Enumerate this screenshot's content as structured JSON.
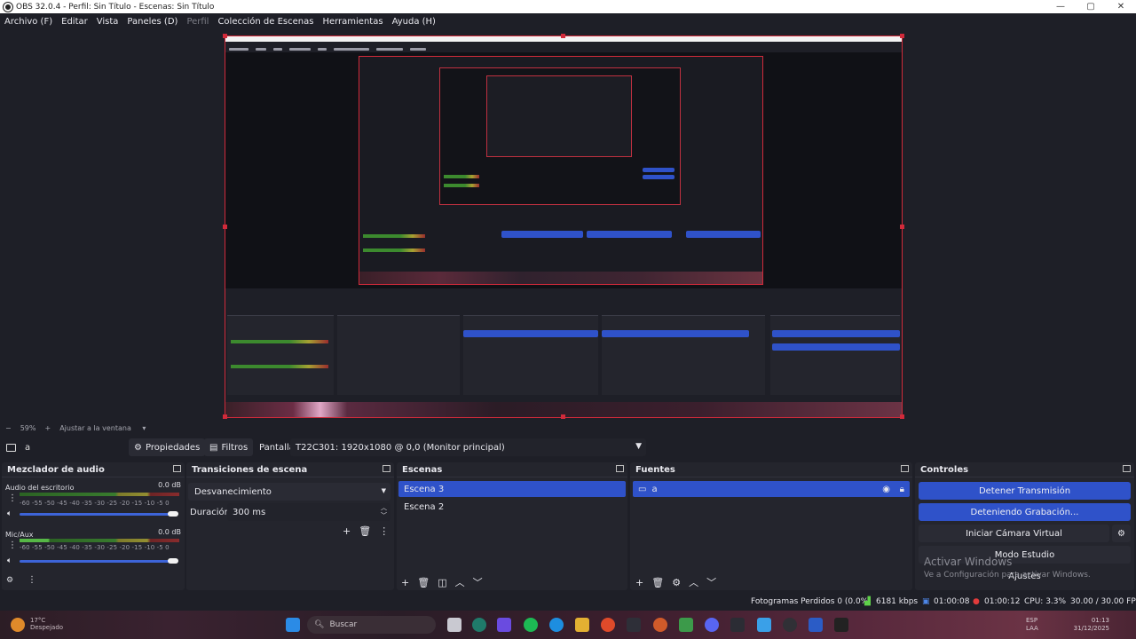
{
  "window": {
    "title": "OBS 32.0.4 - Perfil: Sin Título - Escenas: Sin Título",
    "controls": [
      "—",
      "▢",
      "✕"
    ]
  },
  "menu": [
    {
      "label": "Archivo (F)",
      "disabled": false
    },
    {
      "label": "Editar",
      "disabled": false
    },
    {
      "label": "Vista",
      "disabled": false
    },
    {
      "label": "Paneles (D)",
      "disabled": false
    },
    {
      "label": "Perfil",
      "disabled": true
    },
    {
      "label": "Colección de Escenas",
      "disabled": false
    },
    {
      "label": "Herramientas",
      "disabled": false
    },
    {
      "label": "Ayuda (H)",
      "disabled": false
    }
  ],
  "zoom": {
    "minus": "−",
    "value": "59%",
    "plus": "+",
    "fit": "Ajustar a la ventana"
  },
  "source_bar": {
    "source_name": "a",
    "properties": "Propiedades",
    "filters": "Filtros",
    "display_label": "Pantalla",
    "display_value": "T22C301: 1920x1080 @ 0,0 (Monitor principal)"
  },
  "mixer": {
    "title": "Mezclador de audio",
    "ticks": "-60 -55 -50 -45 -40 -35 -30 -25 -20 -15 -10 -5 0",
    "tracks": [
      {
        "name": "Audio del escritorio",
        "db": "0.0 dB",
        "level": 0.0,
        "volume": 1.0
      },
      {
        "name": "Mic/Aux",
        "db": "0.0 dB",
        "level": 0.18,
        "volume": 1.0
      }
    ]
  },
  "transitions": {
    "title": "Transiciones de escena",
    "selected": "Desvanecimiento",
    "duration_label": "Duración",
    "duration_value": "300 ms"
  },
  "scenes": {
    "title": "Escenas",
    "items": [
      {
        "label": "Escena 3",
        "selected": true
      },
      {
        "label": "Escena 2",
        "selected": false
      }
    ]
  },
  "sources": {
    "title": "Fuentes",
    "items": [
      {
        "label": "a",
        "selected": true
      }
    ]
  },
  "controls": {
    "title": "Controles",
    "stop_stream": "Detener Transmisión",
    "stopping_recording": "Deteniendo Grabación...",
    "virtual_cam": "Iniciar Cámara Virtual",
    "studio_mode": "Modo Estudio",
    "settings": "Ajustes",
    "watermark_title": "Activar Windows",
    "watermark_sub": "Ve a Configuración para activar Windows."
  },
  "status": {
    "dropped_frames": "Fotogramas Perdidos 0 (0.0%)",
    "bitrate": "6181 kbps",
    "stream_time": "01:00:08",
    "rec_time": "01:00:12",
    "cpu": "CPU: 3.3%",
    "fps": "30.00 / 30.00 FPS"
  },
  "taskbar": {
    "weather_temp": "17°C",
    "weather_desc": "Despejado",
    "search_placeholder": "Buscar",
    "lang_top": "ESP",
    "lang_bottom": "LAA",
    "time": "01:13",
    "date": "31/12/2025"
  },
  "colors": {
    "accent": "#2f52c9",
    "selection_border": "#d12a3a",
    "background": "#1e1f27",
    "dock": "#24252d"
  }
}
